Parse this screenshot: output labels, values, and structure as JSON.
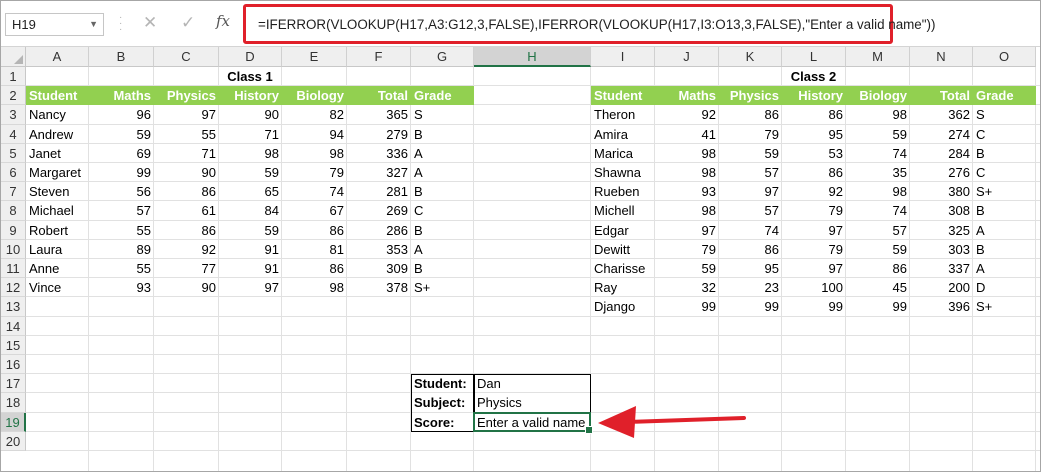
{
  "formula_bar": {
    "name_box": "H19",
    "cancel_icon": "✕",
    "enter_icon": "✓",
    "fx_label": "fx",
    "formula": "=IFERROR(VLOOKUP(H17,A3:G12,3,FALSE),IFERROR(VLOOKUP(H17,I3:O13,3,FALSE),\"Enter a valid name\"))"
  },
  "columns": [
    "A",
    "B",
    "C",
    "D",
    "E",
    "F",
    "G",
    "H",
    "I",
    "J",
    "K",
    "L",
    "M",
    "N",
    "O"
  ],
  "rows": [
    "1",
    "2",
    "3",
    "4",
    "5",
    "6",
    "7",
    "8",
    "9",
    "10",
    "11",
    "12",
    "13",
    "14",
    "15",
    "16",
    "17",
    "18",
    "19",
    "20"
  ],
  "selected_cell": {
    "column": "H",
    "row": "19"
  },
  "class1": {
    "title": "Class 1",
    "headers": [
      "Student",
      "Maths",
      "Physics",
      "History",
      "Biology",
      "Total",
      "Grade"
    ],
    "rows": [
      [
        "Nancy",
        "96",
        "97",
        "90",
        "82",
        "365",
        "S"
      ],
      [
        "Andrew",
        "59",
        "55",
        "71",
        "94",
        "279",
        "B"
      ],
      [
        "Janet",
        "69",
        "71",
        "98",
        "98",
        "336",
        "A"
      ],
      [
        "Margaret",
        "99",
        "90",
        "59",
        "79",
        "327",
        "A"
      ],
      [
        "Steven",
        "56",
        "86",
        "65",
        "74",
        "281",
        "B"
      ],
      [
        "Michael",
        "57",
        "61",
        "84",
        "67",
        "269",
        "C"
      ],
      [
        "Robert",
        "55",
        "86",
        "59",
        "86",
        "286",
        "B"
      ],
      [
        "Laura",
        "89",
        "92",
        "91",
        "81",
        "353",
        "A"
      ],
      [
        "Anne",
        "55",
        "77",
        "91",
        "86",
        "309",
        "B"
      ],
      [
        "Vince",
        "93",
        "90",
        "97",
        "98",
        "378",
        "S+"
      ]
    ]
  },
  "class2": {
    "title": "Class 2",
    "headers": [
      "Student",
      "Maths",
      "Physics",
      "History",
      "Biology",
      "Total",
      "Grade"
    ],
    "rows": [
      [
        "Theron",
        "92",
        "86",
        "86",
        "98",
        "362",
        "S"
      ],
      [
        "Amira",
        "41",
        "79",
        "95",
        "59",
        "274",
        "C"
      ],
      [
        "Marica",
        "98",
        "59",
        "53",
        "74",
        "284",
        "B"
      ],
      [
        "Shawna",
        "98",
        "57",
        "86",
        "35",
        "276",
        "C"
      ],
      [
        "Rueben",
        "93",
        "97",
        "92",
        "98",
        "380",
        "S+"
      ],
      [
        "Michell",
        "98",
        "57",
        "79",
        "74",
        "308",
        "B"
      ],
      [
        "Edgar",
        "97",
        "74",
        "97",
        "57",
        "325",
        "A"
      ],
      [
        "Dewitt",
        "79",
        "86",
        "79",
        "59",
        "303",
        "B"
      ],
      [
        "Charisse",
        "59",
        "95",
        "97",
        "86",
        "337",
        "A"
      ],
      [
        "Ray",
        "32",
        "23",
        "100",
        "45",
        "200",
        "D"
      ],
      [
        "Django",
        "99",
        "99",
        "99",
        "99",
        "396",
        "S+"
      ]
    ]
  },
  "lookup": {
    "rows": [
      {
        "label": "Student:",
        "value": "Dan"
      },
      {
        "label": "Subject:",
        "value": "Physics"
      },
      {
        "label": "Score:",
        "value": "Enter a valid name"
      }
    ]
  },
  "colors": {
    "header_green": "#92d050",
    "highlight_red": "#e0202a",
    "selection_green": "#217346"
  }
}
